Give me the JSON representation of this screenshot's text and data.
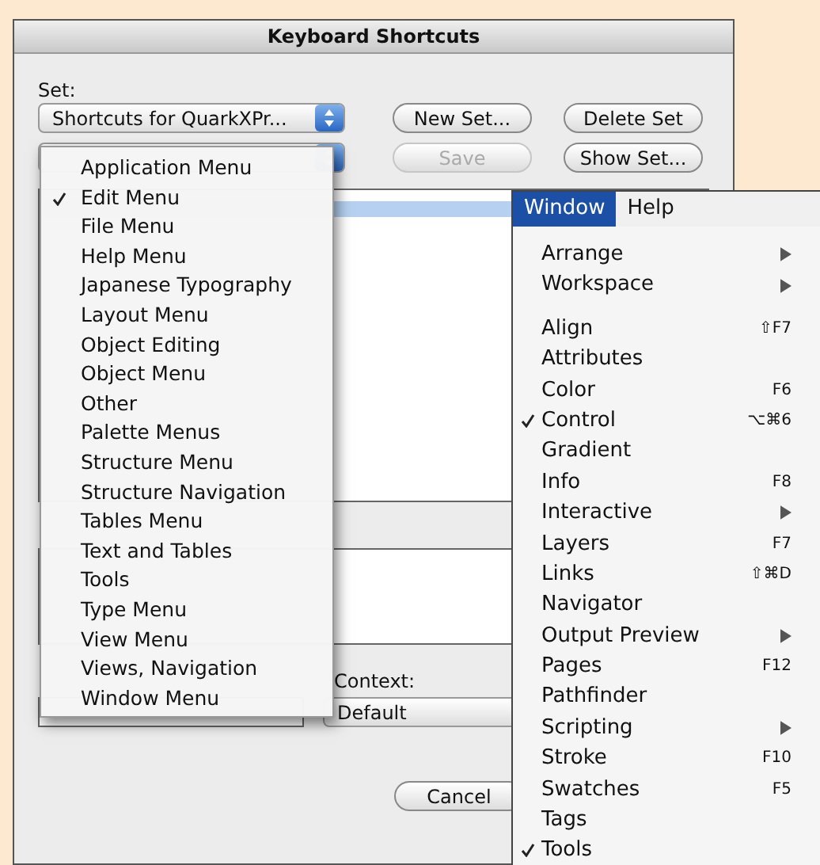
{
  "window": {
    "title": "Keyboard Shortcuts"
  },
  "set_label": "Set:",
  "set_select": {
    "value": "Shortcuts for QuarkXPr..."
  },
  "buttons": [
    {
      "label": "New Set...",
      "disabled": false
    },
    {
      "label": "Delete Set",
      "disabled": false
    },
    {
      "label": "Save",
      "disabled": true
    },
    {
      "label": "Show Set...",
      "disabled": false
    }
  ],
  "context_label": "Context:",
  "context_select": {
    "value": "Default"
  },
  "cancel_button": "Cancel",
  "category_menu": [
    {
      "label": "Application Menu",
      "checked": false
    },
    {
      "label": "Edit Menu",
      "checked": true
    },
    {
      "label": "File Menu",
      "checked": false
    },
    {
      "label": "Help Menu",
      "checked": false
    },
    {
      "label": "Japanese Typography",
      "checked": false
    },
    {
      "label": "Layout Menu",
      "checked": false
    },
    {
      "label": "Object Editing",
      "checked": false
    },
    {
      "label": "Object Menu",
      "checked": false
    },
    {
      "label": "Other",
      "checked": false
    },
    {
      "label": "Palette Menus",
      "checked": false
    },
    {
      "label": "Structure Menu",
      "checked": false
    },
    {
      "label": "Structure Navigation",
      "checked": false
    },
    {
      "label": "Tables Menu",
      "checked": false
    },
    {
      "label": "Text and Tables",
      "checked": false
    },
    {
      "label": "Tools",
      "checked": false
    },
    {
      "label": "Type Menu",
      "checked": false
    },
    {
      "label": "View Menu",
      "checked": false
    },
    {
      "label": "Views, Navigation",
      "checked": false
    },
    {
      "label": "Window Menu",
      "checked": false
    }
  ],
  "menubar": [
    {
      "label": "Window",
      "selected": true
    },
    {
      "label": "Help",
      "selected": false
    }
  ],
  "window_menu": [
    {
      "kind": "item",
      "label": "Arrange",
      "checked": false,
      "submenu": true
    },
    {
      "kind": "item",
      "label": "Workspace",
      "checked": false,
      "submenu": true
    },
    {
      "kind": "separator"
    },
    {
      "kind": "item",
      "label": "Align",
      "checked": false,
      "shortcut": "⇧F7"
    },
    {
      "kind": "item",
      "label": "Attributes",
      "checked": false
    },
    {
      "kind": "item",
      "label": "Color",
      "checked": false,
      "shortcut": "F6"
    },
    {
      "kind": "item",
      "label": "Control",
      "checked": true,
      "shortcut": "⌥⌘6"
    },
    {
      "kind": "item",
      "label": "Gradient",
      "checked": false
    },
    {
      "kind": "item",
      "label": "Info",
      "checked": false,
      "shortcut": "F8"
    },
    {
      "kind": "item",
      "label": "Interactive",
      "checked": false,
      "submenu": true
    },
    {
      "kind": "item",
      "label": "Layers",
      "checked": false,
      "shortcut": "F7"
    },
    {
      "kind": "item",
      "label": "Links",
      "checked": false,
      "shortcut": "⇧⌘D"
    },
    {
      "kind": "item",
      "label": "Navigator",
      "checked": false
    },
    {
      "kind": "item",
      "label": "Output Preview",
      "checked": false,
      "submenu": true
    },
    {
      "kind": "item",
      "label": "Pages",
      "checked": false,
      "shortcut": "F12"
    },
    {
      "kind": "item",
      "label": "Pathfinder",
      "checked": false
    },
    {
      "kind": "item",
      "label": "Scripting",
      "checked": false,
      "submenu": true
    },
    {
      "kind": "item",
      "label": "Stroke",
      "checked": false,
      "shortcut": "F10"
    },
    {
      "kind": "item",
      "label": "Swatches",
      "checked": false,
      "shortcut": "F5"
    },
    {
      "kind": "item",
      "label": "Tags",
      "checked": false
    },
    {
      "kind": "item",
      "label": "Tools",
      "checked": true
    }
  ]
}
